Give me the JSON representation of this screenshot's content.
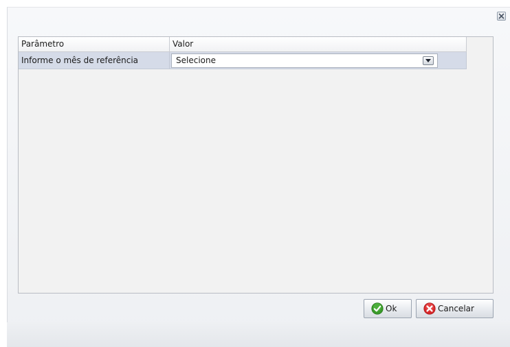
{
  "dialog": {
    "close_icon": "close-icon"
  },
  "grid": {
    "columns": [
      "Parâmetro",
      "Valor"
    ],
    "rows": [
      {
        "parameter": "Informe o mês de referência",
        "value": "Selecione"
      }
    ]
  },
  "buttons": {
    "ok_label": "Ok",
    "ok_icon": "check-icon",
    "cancel_label": "Cancelar",
    "cancel_icon": "cancel-icon"
  },
  "colors": {
    "row_highlight": "#d5dbe8",
    "ok_green": "#3a9b2a",
    "cancel_red": "#d8282a"
  }
}
